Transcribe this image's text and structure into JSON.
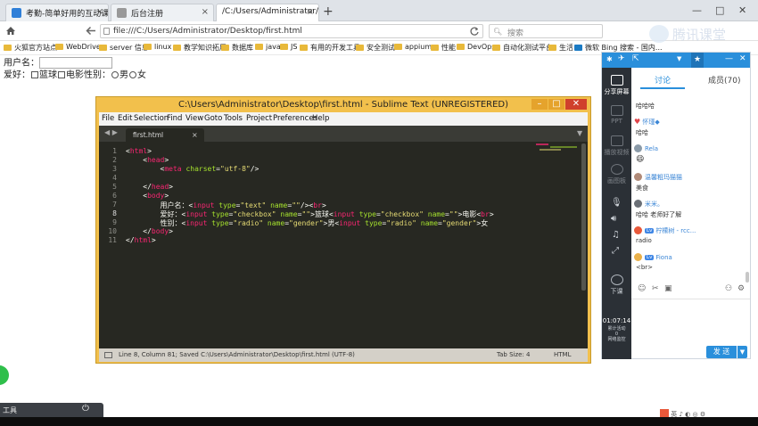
{
  "browser": {
    "tabs": [
      {
        "title": "考勤-简单好用的互动课堂软件"
      },
      {
        "title": "后台注册"
      },
      {
        "title": "/C:/Users/Administrator/Desk..."
      }
    ],
    "new_tab_glyph": "+",
    "window_controls": [
      "—",
      "□",
      "✕"
    ],
    "url": "file:///C:/Users/Administrator/Desktop/first.html",
    "search_placeholder": "搜索",
    "bookmarks": [
      "火狐官方站点",
      "WebDriver",
      "server 信息",
      "linux",
      "教学知识拓展",
      "数据库",
      "java",
      "JS",
      "有用的开发工具",
      "安全测试",
      "appium",
      "性能",
      "DevOps",
      "自动化测试平台",
      "生活",
      "微软 Bing 搜索 - 国内..."
    ],
    "icons": {
      "home": "home-icon",
      "back": "back-arrow-icon",
      "reload": "reload-icon"
    }
  },
  "page": {
    "username_label": "用户名：",
    "hobby_label": "爱好：",
    "hobby1": "篮球",
    "hobby2": "电影",
    "gender_label": "性别：",
    "gender1": "男",
    "gender2": "女"
  },
  "sublime": {
    "title": "C:\\Users\\Administrator\\Desktop\\first.html - Sublime Text (UNREGISTERED)",
    "menu": [
      "File",
      "Edit",
      "Selection",
      "Find",
      "View",
      "Goto",
      "Tools",
      "Project",
      "Preferences",
      "Help"
    ],
    "tab_name": "first.html",
    "line_numbers": [
      "1",
      "2",
      "3",
      "4",
      "5",
      "6",
      "7",
      "8",
      "9",
      "10",
      "11"
    ],
    "status_left": "Line 8, Column 81; Saved C:\\Users\\Administrator\\Desktop\\first.html (UTF-8)",
    "tab_size": "Tab Size: 4",
    "syntax": "HTML"
  },
  "chat_panel": {
    "side_buttons": [
      "分享屏幕",
      "PPT",
      "播放视频",
      "画图板",
      "下课"
    ],
    "timer": "01:07:14",
    "timer_sub1": "累计活动",
    "timer_sub2": "0",
    "timer_sub3": "网络监控",
    "tab_discuss": "讨论",
    "tab_members": "成员(70)",
    "messages": [
      {
        "user": "",
        "text": "哈哈哈"
      },
      {
        "user": "怀瑾◆",
        "text": "哈哈"
      },
      {
        "user": "Rela",
        "text": "😄"
      },
      {
        "user": "温馨粗玛猫猫",
        "text": "美食"
      },
      {
        "user": "米米。",
        "text": "哈哈 老师好了解"
      },
      {
        "user": "柠檬树 - rcc...",
        "text": "radio"
      },
      {
        "user": "Fiona",
        "text": "<br>"
      }
    ],
    "send_label": "发 送",
    "watermark": "腾讯课堂"
  },
  "taskbar": {
    "left_label": "工具"
  }
}
